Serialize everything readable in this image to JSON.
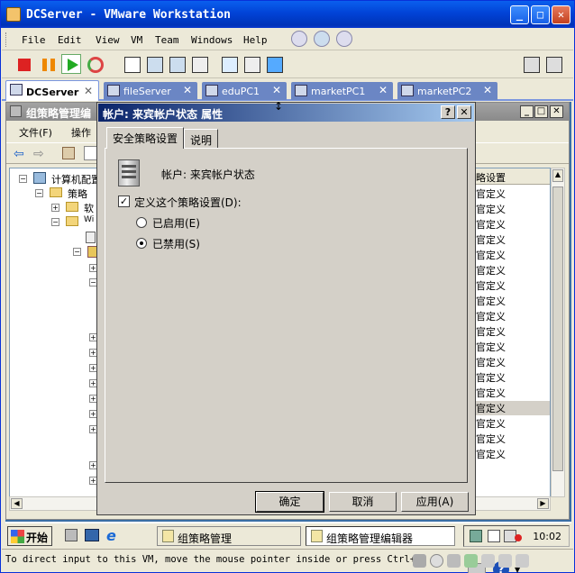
{
  "host": {
    "title": "DCServer - VMware Workstation",
    "menu": [
      "File",
      "Edit",
      "View",
      "VM",
      "Team",
      "Windows",
      "Help"
    ],
    "tabs": [
      {
        "label": "DCServer",
        "active": true
      },
      {
        "label": "fileServer",
        "active": false
      },
      {
        "label": "eduPC1",
        "active": false
      },
      {
        "label": "marketPC1",
        "active": false
      },
      {
        "label": "marketPC2",
        "active": false
      }
    ],
    "tab_close_glyph": "✕",
    "status_text": "To direct input to this VM, move the mouse pointer inside or press Ctrl+G."
  },
  "mmc": {
    "title": "组策略管理编",
    "menu": [
      "文件(F)",
      "操作"
    ],
    "tree": [
      {
        "label": "计算机配置",
        "expander": "−"
      },
      {
        "label": "策略",
        "expander": "−"
      },
      {
        "label": "软",
        "expander": "+"
      },
      {
        "label": "Wi",
        "expander": "−"
      }
    ],
    "list_header": "略设置",
    "list_rows": [
      "官定义",
      "官定义",
      "官定义",
      "官定义",
      "官定义",
      "官定义",
      "官定义",
      "官定义",
      "官定义",
      "官定义",
      "官定义",
      "官定义",
      "官定义",
      "官定义",
      "官定义",
      "官定义",
      "官定义",
      "官定义"
    ]
  },
  "dialog": {
    "title": "帐户: 来宾帐户状态 属性",
    "help_btn": "?",
    "close_btn": "✕",
    "tabs": [
      "安全策略设置",
      "说明"
    ],
    "account_label": "帐户: 来宾帐户状态",
    "define_checkbox_label": "定义这个策略设置(D):",
    "define_checked": true,
    "radio_enabled_label": "已启用(E)",
    "radio_disabled_label": "已禁用(S)",
    "selected": "disabled",
    "ok": "确定",
    "cancel": "取消",
    "apply": "应用(A)"
  },
  "taskbar": {
    "start": "开始",
    "items": [
      {
        "label": "组策略管理",
        "active": false
      },
      {
        "label": "组策略管理编辑器",
        "active": true
      }
    ],
    "clock": "10:02"
  },
  "colors": {
    "xp_blue": "#0143d6",
    "dialog_title_start": "#0a246a",
    "dialog_title_end": "#a6caf0"
  }
}
